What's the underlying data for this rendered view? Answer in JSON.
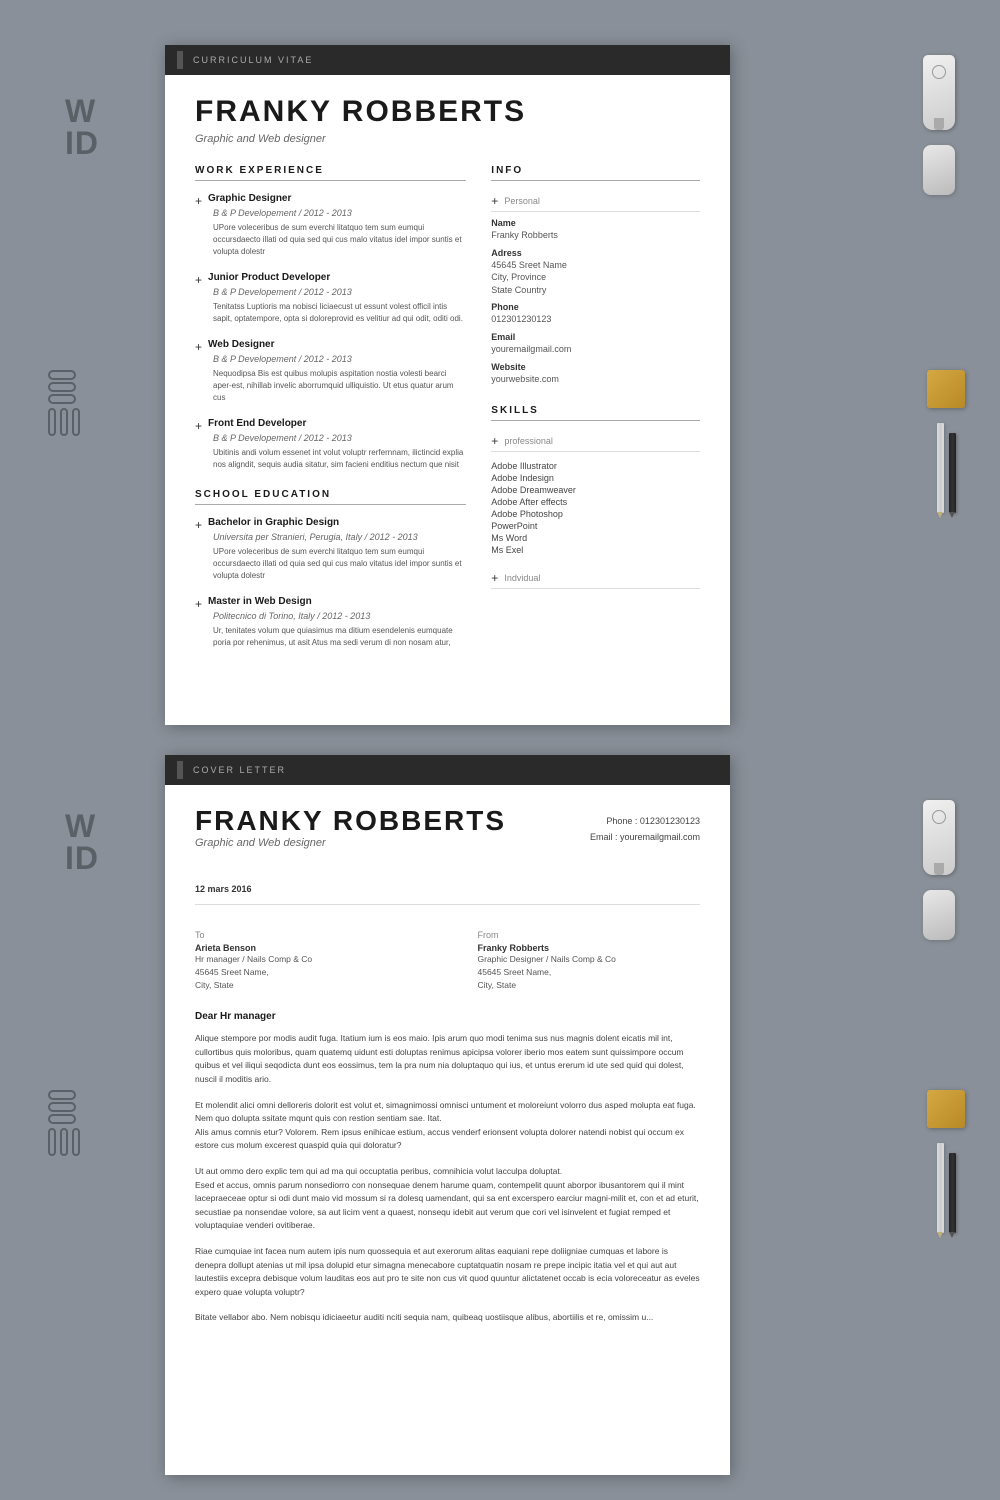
{
  "resume": {
    "docType": "CURRICULUM VITAE",
    "name": "FRANKY ROBBERTS",
    "subtitle": "Graphic and Web designer",
    "sections": {
      "workExperience": {
        "title": "WORK EXPERIENCE",
        "jobs": [
          {
            "title": "Graphic Designer",
            "meta": "B & P Developement / 2012 - 2013",
            "desc": "UPore voleceribus de sum everchi litatquo tem sum eumqui occursdaecto illati od quia sed qui cus malo vitatus idel impor suntis et volupta dolestr"
          },
          {
            "title": "Junior Product Developer",
            "meta": "B & P Developement / 2012 - 2013",
            "desc": "Tenitatss Luptioris ma nobisci liciaecust ut essunt volest officil intis sapit, optatempore, opta si doloreprovid es velitiur ad qui odit, oditi odi."
          },
          {
            "title": "Web Designer",
            "meta": "B & P Developement / 2012 - 2013",
            "desc": "Nequodipsa Bis est quibus molupis aspitation nostia volesti bearci aper-est, nihillab invelic aborrumquid ulliquistio. Ut etus quatur arum cus"
          },
          {
            "title": "Front End Developer",
            "meta": "B & P Developement / 2012 - 2013",
            "desc": "Ubitinis andi volum essenet int volut voluptr rerfernnam, ilictincid explia nos aligndit, sequis audia sitatur, sim facieni enditius nectum que nisit"
          }
        ]
      },
      "schoolEducation": {
        "title": "SCHOOL EDUCATION",
        "items": [
          {
            "title": "Bachelor in Graphic Design",
            "meta": "Universita per Stranieri, Perugia, Italy / 2012 - 2013",
            "desc": "UPore voleceribus de sum everchi litatquo tem sum eumqui occursdaecto illati od quia sed qui cus malo vitatus idel impor suntis et volupta dolestr"
          },
          {
            "title": "Master in Web Design",
            "meta": "Politecnico di Torino, Italy / 2012 - 2013",
            "desc": "Ur, tenitates volum que quiasimus ma ditium esendelenis eumquate poria por rehenimus, ut asit Atus ma sedi verum di non nosam atur,"
          }
        ]
      },
      "info": {
        "title": "INFO",
        "subsectionLabel": "Personal",
        "name_label": "Name",
        "name_value": "Franky Robberts",
        "address_label": "Adress",
        "address_value": "45645 Sreet Name\nCity, Province\nState Country",
        "phone_label": "Phone",
        "phone_value": "012301230123",
        "email_label": "Email",
        "email_value": "youremailgmail.com",
        "website_label": "Website",
        "website_value": "yourwebsite.com"
      },
      "skills": {
        "title": "SKILLS",
        "professional_label": "professional",
        "professional_items": [
          "Adobe Illustrator",
          "Adobe Indesign",
          "Adobe Dreamweaver",
          "Adobe After effects",
          "Adobe Photoshop",
          "PowerPoint",
          "Ms Word",
          "Ms Exel"
        ],
        "individual_label": "Indvidual"
      }
    }
  },
  "cover_letter": {
    "docType": "COVER LETTER",
    "name": "FRANKY ROBBERTS",
    "subtitle": "Graphic and Web designer",
    "phone_label": "Phone :",
    "phone_value": "012301230123",
    "email_label": "Email :",
    "email_value": "youremailgmail.com",
    "date": "12 mars 2016",
    "to": {
      "label": "To",
      "name": "Arieta Benson",
      "role": "Hr manager / Nails Comp & Co",
      "address": "45645 Sreet Name,\nCity, State"
    },
    "from": {
      "label": "From",
      "name": "Franky Robberts",
      "role": "Graphic Designer / Nails Comp & Co",
      "address": "45645 Sreet Name,\nCity, State"
    },
    "dear": "Dear Hr manager",
    "paragraphs": [
      "Alique stempore por modis audit fuga. Itatium ium is eos maio. Ipis arum quo modi tenima sus nus magnis dolent eicatis mil int, cullortibus quis moloribus, quam quatemq uidunt esti doluptas renimus apicipsa volorer iberio mos eatem sunt quissimpore occum quibus et vel iliqui seqodicta dunt eos eossimus, tem la pra num nia doluptaquo qui ius, et untus ererum id ute sed quid qui dolest, nuscil il moditis ario.",
      "Et molendit alici omni delloreris dolorit est volut et, simagnimossi omnisci untument et moloreiunt volorro dus asped molupta eat fuga. Nem quo dolupta ssitate mqunt quis con restion sentiam sae. Itat.\nAlis amus comnis etur? Volorem. Rem ipsus enihicae estium, accus venderf erionsent volupta dolorer natendi nobist qui occum ex estore cus molum excerest quaspid quia qui doloratur?",
      "Ut aut ommo dero explic tem qui ad ma qui occuptatia peribus, comnihicia volut lacculpa doluptat.\nEsed et accus, omnis parum nonsediorro con nonsequae denem harume quam, contempelit quunt aborpor ibusantorem qui il mint lacepraeceae optur si odi dunt maio vid mossum si ra dolesq uamendant, qui sa ent excerspero earciur magni-milit et, con et ad eturit, secustiae pa nonsendae volore, sa aut licim vent a quaest, nonsequ idebit aut verum que cori vel isinvelent et fugiat remped et voluptaquiae venderi ovitiberae.",
      "Riae cumquiae int facea num autem ipis num quossequia et aut exerorum alitas eaquiani repe doliigniae cumquas et labore is denepra dollupt atenias ut mil ipsa dolupid etur simagna menecabore cuptatquatin nosam re prepe incipic itatia vel et qui aut aut lautestiis excepra debisque volum lauditas eos aut pro te site non cus vit quod quuntur alictatenet occab is ecia voloreceatur as eveles expero quae volupta voluptr?",
      "Bitate vellabor abo. Nem nobisqu idiciaeetur auditi nciti sequia nam, quibeaq uostiisque alibus, abortiilis et re, omissim u..."
    ]
  },
  "watermark1": {
    "line1": "W",
    "line2": "ID"
  },
  "watermark2": {
    "line1": "W",
    "line2": "ID"
  }
}
